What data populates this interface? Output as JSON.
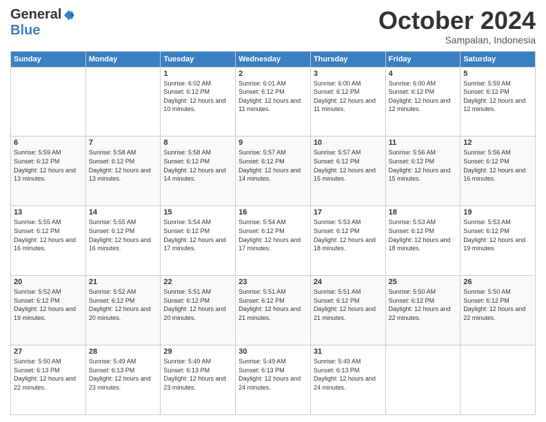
{
  "logo": {
    "general": "General",
    "blue": "Blue"
  },
  "header": {
    "month": "October 2024",
    "location": "Sampalan, Indonesia"
  },
  "days_of_week": [
    "Sunday",
    "Monday",
    "Tuesday",
    "Wednesday",
    "Thursday",
    "Friday",
    "Saturday"
  ],
  "weeks": [
    [
      {
        "day": "",
        "info": ""
      },
      {
        "day": "",
        "info": ""
      },
      {
        "day": "1",
        "info": "Sunrise: 6:02 AM\nSunset: 6:12 PM\nDaylight: 12 hours and 10 minutes."
      },
      {
        "day": "2",
        "info": "Sunrise: 6:01 AM\nSunset: 6:12 PM\nDaylight: 12 hours and 11 minutes."
      },
      {
        "day": "3",
        "info": "Sunrise: 6:00 AM\nSunset: 6:12 PM\nDaylight: 12 hours and 11 minutes."
      },
      {
        "day": "4",
        "info": "Sunrise: 6:00 AM\nSunset: 6:12 PM\nDaylight: 12 hours and 12 minutes."
      },
      {
        "day": "5",
        "info": "Sunrise: 5:59 AM\nSunset: 6:12 PM\nDaylight: 12 hours and 12 minutes."
      }
    ],
    [
      {
        "day": "6",
        "info": "Sunrise: 5:59 AM\nSunset: 6:12 PM\nDaylight: 12 hours and 13 minutes."
      },
      {
        "day": "7",
        "info": "Sunrise: 5:58 AM\nSunset: 6:12 PM\nDaylight: 12 hours and 13 minutes."
      },
      {
        "day": "8",
        "info": "Sunrise: 5:58 AM\nSunset: 6:12 PM\nDaylight: 12 hours and 14 minutes."
      },
      {
        "day": "9",
        "info": "Sunrise: 5:57 AM\nSunset: 6:12 PM\nDaylight: 12 hours and 14 minutes."
      },
      {
        "day": "10",
        "info": "Sunrise: 5:57 AM\nSunset: 6:12 PM\nDaylight: 12 hours and 15 minutes."
      },
      {
        "day": "11",
        "info": "Sunrise: 5:56 AM\nSunset: 6:12 PM\nDaylight: 12 hours and 15 minutes."
      },
      {
        "day": "12",
        "info": "Sunrise: 5:56 AM\nSunset: 6:12 PM\nDaylight: 12 hours and 16 minutes."
      }
    ],
    [
      {
        "day": "13",
        "info": "Sunrise: 5:55 AM\nSunset: 6:12 PM\nDaylight: 12 hours and 16 minutes."
      },
      {
        "day": "14",
        "info": "Sunrise: 5:55 AM\nSunset: 6:12 PM\nDaylight: 12 hours and 16 minutes."
      },
      {
        "day": "15",
        "info": "Sunrise: 5:54 AM\nSunset: 6:12 PM\nDaylight: 12 hours and 17 minutes."
      },
      {
        "day": "16",
        "info": "Sunrise: 5:54 AM\nSunset: 6:12 PM\nDaylight: 12 hours and 17 minutes."
      },
      {
        "day": "17",
        "info": "Sunrise: 5:53 AM\nSunset: 6:12 PM\nDaylight: 12 hours and 18 minutes."
      },
      {
        "day": "18",
        "info": "Sunrise: 5:53 AM\nSunset: 6:12 PM\nDaylight: 12 hours and 18 minutes."
      },
      {
        "day": "19",
        "info": "Sunrise: 5:53 AM\nSunset: 6:12 PM\nDaylight: 12 hours and 19 minutes."
      }
    ],
    [
      {
        "day": "20",
        "info": "Sunrise: 5:52 AM\nSunset: 6:12 PM\nDaylight: 12 hours and 19 minutes."
      },
      {
        "day": "21",
        "info": "Sunrise: 5:52 AM\nSunset: 6:12 PM\nDaylight: 12 hours and 20 minutes."
      },
      {
        "day": "22",
        "info": "Sunrise: 5:51 AM\nSunset: 6:12 PM\nDaylight: 12 hours and 20 minutes."
      },
      {
        "day": "23",
        "info": "Sunrise: 5:51 AM\nSunset: 6:12 PM\nDaylight: 12 hours and 21 minutes."
      },
      {
        "day": "24",
        "info": "Sunrise: 5:51 AM\nSunset: 6:12 PM\nDaylight: 12 hours and 21 minutes."
      },
      {
        "day": "25",
        "info": "Sunrise: 5:50 AM\nSunset: 6:12 PM\nDaylight: 12 hours and 22 minutes."
      },
      {
        "day": "26",
        "info": "Sunrise: 5:50 AM\nSunset: 6:12 PM\nDaylight: 12 hours and 22 minutes."
      }
    ],
    [
      {
        "day": "27",
        "info": "Sunrise: 5:50 AM\nSunset: 6:13 PM\nDaylight: 12 hours and 22 minutes."
      },
      {
        "day": "28",
        "info": "Sunrise: 5:49 AM\nSunset: 6:13 PM\nDaylight: 12 hours and 23 minutes."
      },
      {
        "day": "29",
        "info": "Sunrise: 5:49 AM\nSunset: 6:13 PM\nDaylight: 12 hours and 23 minutes."
      },
      {
        "day": "30",
        "info": "Sunrise: 5:49 AM\nSunset: 6:13 PM\nDaylight: 12 hours and 24 minutes."
      },
      {
        "day": "31",
        "info": "Sunrise: 5:49 AM\nSunset: 6:13 PM\nDaylight: 12 hours and 24 minutes."
      },
      {
        "day": "",
        "info": ""
      },
      {
        "day": "",
        "info": ""
      }
    ]
  ]
}
